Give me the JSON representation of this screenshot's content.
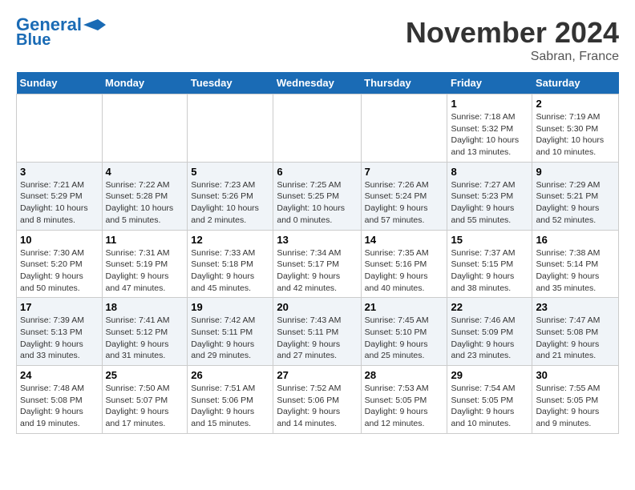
{
  "header": {
    "logo_general": "General",
    "logo_blue": "Blue",
    "month_title": "November 2024",
    "location": "Sabran, France"
  },
  "days_of_week": [
    "Sunday",
    "Monday",
    "Tuesday",
    "Wednesday",
    "Thursday",
    "Friday",
    "Saturday"
  ],
  "weeks": [
    [
      {
        "day": "",
        "info": ""
      },
      {
        "day": "",
        "info": ""
      },
      {
        "day": "",
        "info": ""
      },
      {
        "day": "",
        "info": ""
      },
      {
        "day": "",
        "info": ""
      },
      {
        "day": "1",
        "info": "Sunrise: 7:18 AM\nSunset: 5:32 PM\nDaylight: 10 hours\nand 13 minutes."
      },
      {
        "day": "2",
        "info": "Sunrise: 7:19 AM\nSunset: 5:30 PM\nDaylight: 10 hours\nand 10 minutes."
      }
    ],
    [
      {
        "day": "3",
        "info": "Sunrise: 7:21 AM\nSunset: 5:29 PM\nDaylight: 10 hours\nand 8 minutes."
      },
      {
        "day": "4",
        "info": "Sunrise: 7:22 AM\nSunset: 5:28 PM\nDaylight: 10 hours\nand 5 minutes."
      },
      {
        "day": "5",
        "info": "Sunrise: 7:23 AM\nSunset: 5:26 PM\nDaylight: 10 hours\nand 2 minutes."
      },
      {
        "day": "6",
        "info": "Sunrise: 7:25 AM\nSunset: 5:25 PM\nDaylight: 10 hours\nand 0 minutes."
      },
      {
        "day": "7",
        "info": "Sunrise: 7:26 AM\nSunset: 5:24 PM\nDaylight: 9 hours\nand 57 minutes."
      },
      {
        "day": "8",
        "info": "Sunrise: 7:27 AM\nSunset: 5:23 PM\nDaylight: 9 hours\nand 55 minutes."
      },
      {
        "day": "9",
        "info": "Sunrise: 7:29 AM\nSunset: 5:21 PM\nDaylight: 9 hours\nand 52 minutes."
      }
    ],
    [
      {
        "day": "10",
        "info": "Sunrise: 7:30 AM\nSunset: 5:20 PM\nDaylight: 9 hours\nand 50 minutes."
      },
      {
        "day": "11",
        "info": "Sunrise: 7:31 AM\nSunset: 5:19 PM\nDaylight: 9 hours\nand 47 minutes."
      },
      {
        "day": "12",
        "info": "Sunrise: 7:33 AM\nSunset: 5:18 PM\nDaylight: 9 hours\nand 45 minutes."
      },
      {
        "day": "13",
        "info": "Sunrise: 7:34 AM\nSunset: 5:17 PM\nDaylight: 9 hours\nand 42 minutes."
      },
      {
        "day": "14",
        "info": "Sunrise: 7:35 AM\nSunset: 5:16 PM\nDaylight: 9 hours\nand 40 minutes."
      },
      {
        "day": "15",
        "info": "Sunrise: 7:37 AM\nSunset: 5:15 PM\nDaylight: 9 hours\nand 38 minutes."
      },
      {
        "day": "16",
        "info": "Sunrise: 7:38 AM\nSunset: 5:14 PM\nDaylight: 9 hours\nand 35 minutes."
      }
    ],
    [
      {
        "day": "17",
        "info": "Sunrise: 7:39 AM\nSunset: 5:13 PM\nDaylight: 9 hours\nand 33 minutes."
      },
      {
        "day": "18",
        "info": "Sunrise: 7:41 AM\nSunset: 5:12 PM\nDaylight: 9 hours\nand 31 minutes."
      },
      {
        "day": "19",
        "info": "Sunrise: 7:42 AM\nSunset: 5:11 PM\nDaylight: 9 hours\nand 29 minutes."
      },
      {
        "day": "20",
        "info": "Sunrise: 7:43 AM\nSunset: 5:11 PM\nDaylight: 9 hours\nand 27 minutes."
      },
      {
        "day": "21",
        "info": "Sunrise: 7:45 AM\nSunset: 5:10 PM\nDaylight: 9 hours\nand 25 minutes."
      },
      {
        "day": "22",
        "info": "Sunrise: 7:46 AM\nSunset: 5:09 PM\nDaylight: 9 hours\nand 23 minutes."
      },
      {
        "day": "23",
        "info": "Sunrise: 7:47 AM\nSunset: 5:08 PM\nDaylight: 9 hours\nand 21 minutes."
      }
    ],
    [
      {
        "day": "24",
        "info": "Sunrise: 7:48 AM\nSunset: 5:08 PM\nDaylight: 9 hours\nand 19 minutes."
      },
      {
        "day": "25",
        "info": "Sunrise: 7:50 AM\nSunset: 5:07 PM\nDaylight: 9 hours\nand 17 minutes."
      },
      {
        "day": "26",
        "info": "Sunrise: 7:51 AM\nSunset: 5:06 PM\nDaylight: 9 hours\nand 15 minutes."
      },
      {
        "day": "27",
        "info": "Sunrise: 7:52 AM\nSunset: 5:06 PM\nDaylight: 9 hours\nand 14 minutes."
      },
      {
        "day": "28",
        "info": "Sunrise: 7:53 AM\nSunset: 5:05 PM\nDaylight: 9 hours\nand 12 minutes."
      },
      {
        "day": "29",
        "info": "Sunrise: 7:54 AM\nSunset: 5:05 PM\nDaylight: 9 hours\nand 10 minutes."
      },
      {
        "day": "30",
        "info": "Sunrise: 7:55 AM\nSunset: 5:05 PM\nDaylight: 9 hours\nand 9 minutes."
      }
    ]
  ]
}
